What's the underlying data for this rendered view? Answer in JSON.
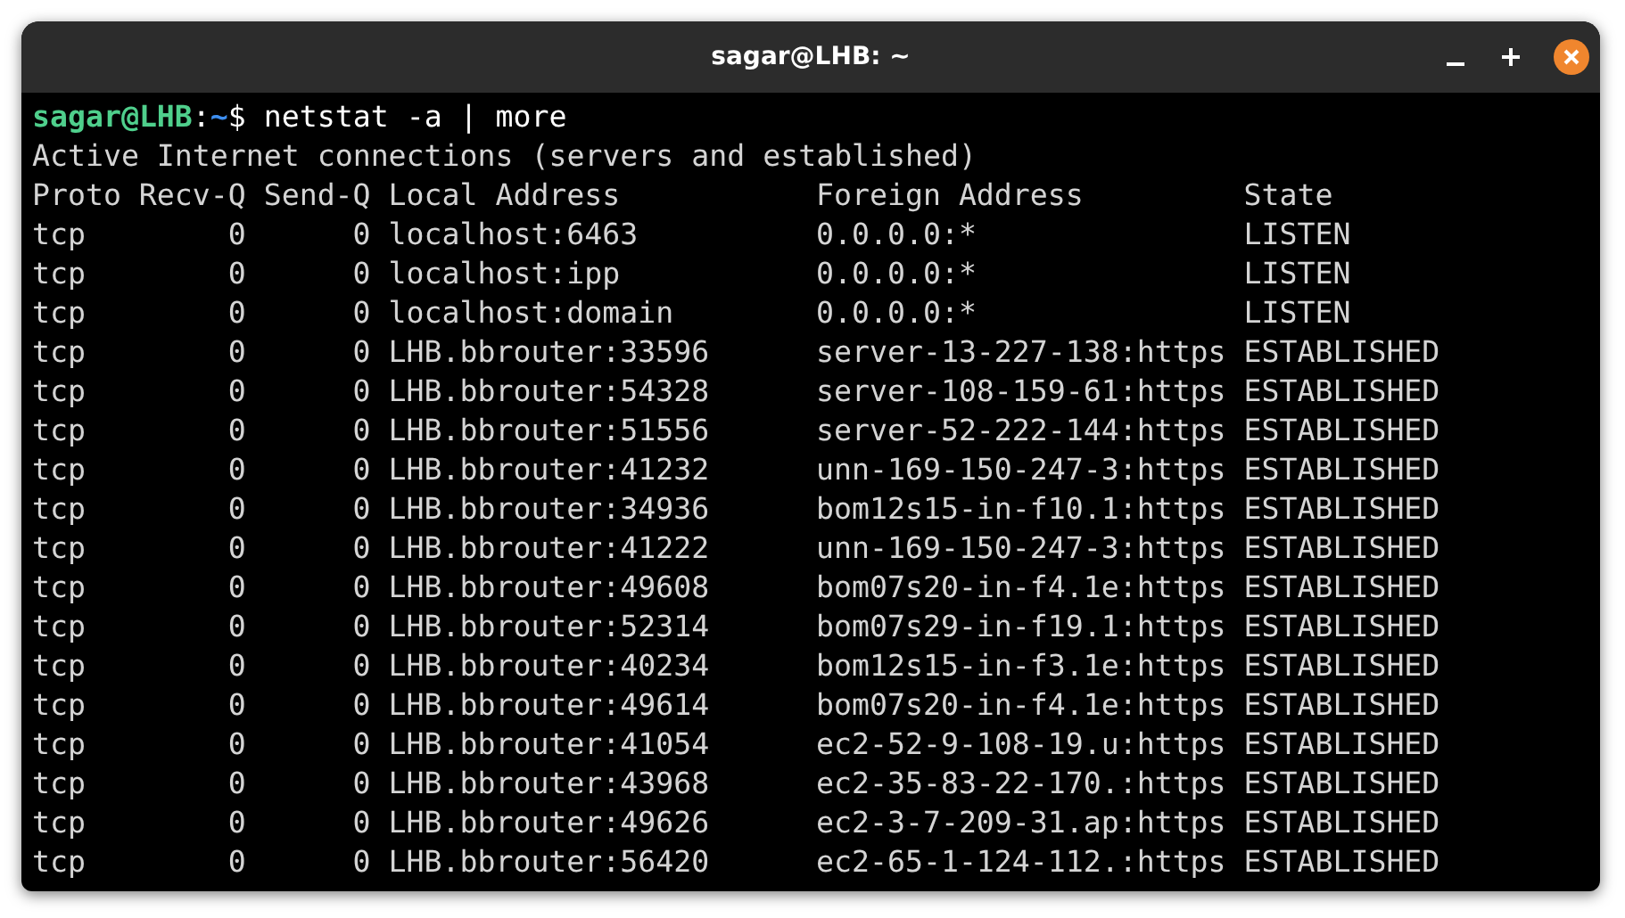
{
  "window": {
    "title": "sagar@LHB: ~"
  },
  "prompt": {
    "user_host": "sagar@LHB",
    "separator": ":",
    "path": "~",
    "symbol": "$",
    "command": "netstat -a | more"
  },
  "output_heading": "Active Internet connections (servers and established)",
  "table": {
    "columns": [
      "Proto",
      "Recv-Q",
      "Send-Q",
      "Local Address",
      "Foreign Address",
      "State"
    ],
    "rows": [
      [
        "tcp",
        "0",
        "0",
        "localhost:6463",
        "0.0.0.0:*",
        "LISTEN"
      ],
      [
        "tcp",
        "0",
        "0",
        "localhost:ipp",
        "0.0.0.0:*",
        "LISTEN"
      ],
      [
        "tcp",
        "0",
        "0",
        "localhost:domain",
        "0.0.0.0:*",
        "LISTEN"
      ],
      [
        "tcp",
        "0",
        "0",
        "LHB.bbrouter:33596",
        "server-13-227-138:https",
        "ESTABLISHED"
      ],
      [
        "tcp",
        "0",
        "0",
        "LHB.bbrouter:54328",
        "server-108-159-61:https",
        "ESTABLISHED"
      ],
      [
        "tcp",
        "0",
        "0",
        "LHB.bbrouter:51556",
        "server-52-222-144:https",
        "ESTABLISHED"
      ],
      [
        "tcp",
        "0",
        "0",
        "LHB.bbrouter:41232",
        "unn-169-150-247-3:https",
        "ESTABLISHED"
      ],
      [
        "tcp",
        "0",
        "0",
        "LHB.bbrouter:34936",
        "bom12s15-in-f10.1:https",
        "ESTABLISHED"
      ],
      [
        "tcp",
        "0",
        "0",
        "LHB.bbrouter:41222",
        "unn-169-150-247-3:https",
        "ESTABLISHED"
      ],
      [
        "tcp",
        "0",
        "0",
        "LHB.bbrouter:49608",
        "bom07s20-in-f4.1e:https",
        "ESTABLISHED"
      ],
      [
        "tcp",
        "0",
        "0",
        "LHB.bbrouter:52314",
        "bom07s29-in-f19.1:https",
        "ESTABLISHED"
      ],
      [
        "tcp",
        "0",
        "0",
        "LHB.bbrouter:40234",
        "bom12s15-in-f3.1e:https",
        "ESTABLISHED"
      ],
      [
        "tcp",
        "0",
        "0",
        "LHB.bbrouter:49614",
        "bom07s20-in-f4.1e:https",
        "ESTABLISHED"
      ],
      [
        "tcp",
        "0",
        "0",
        "LHB.bbrouter:41054",
        "ec2-52-9-108-19.u:https",
        "ESTABLISHED"
      ],
      [
        "tcp",
        "0",
        "0",
        "LHB.bbrouter:43968",
        "ec2-35-83-22-170.:https",
        "ESTABLISHED"
      ],
      [
        "tcp",
        "0",
        "0",
        "LHB.bbrouter:49626",
        "ec2-3-7-209-31.ap:https",
        "ESTABLISHED"
      ],
      [
        "tcp",
        "0",
        "0",
        "LHB.bbrouter:56420",
        "ec2-65-1-124-112.:https",
        "ESTABLISHED"
      ]
    ]
  }
}
